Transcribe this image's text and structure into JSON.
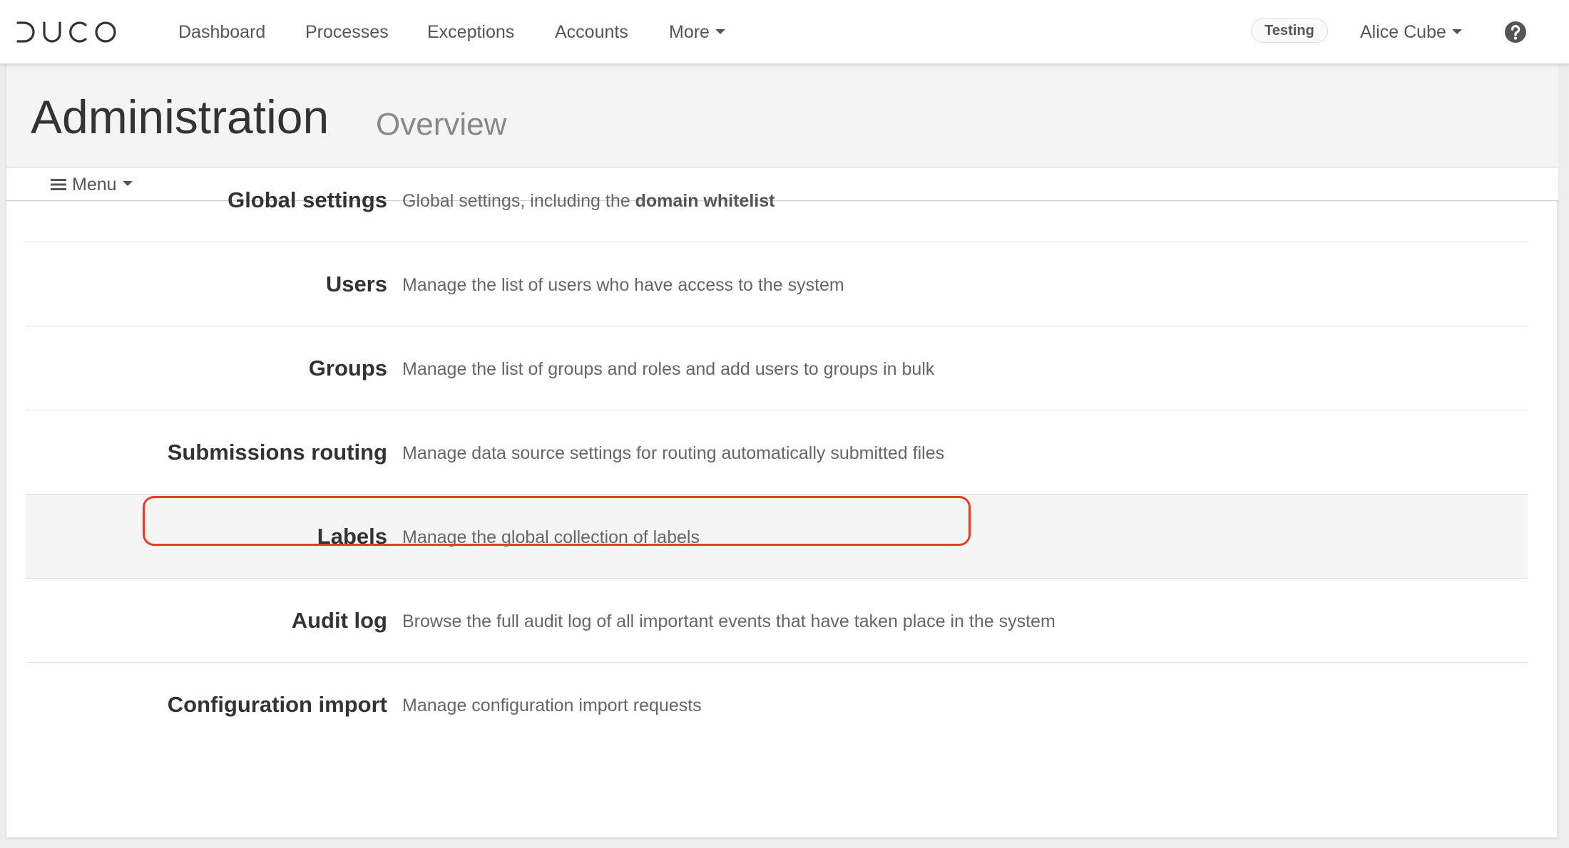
{
  "app": {
    "logo_text": "DUCO"
  },
  "nav": {
    "items": [
      {
        "label": "Dashboard"
      },
      {
        "label": "Processes"
      },
      {
        "label": "Exceptions"
      },
      {
        "label": "Accounts"
      },
      {
        "label": "More"
      }
    ],
    "environment_badge": "Testing",
    "user_name": "Alice Cube",
    "help_icon": "question-circle-icon"
  },
  "page": {
    "title": "Administration",
    "subtitle": "Overview",
    "menu_label": "Menu"
  },
  "admin_items": [
    {
      "title": "Global settings",
      "description": "Global settings, including the ",
      "description_bold": "domain whitelist"
    },
    {
      "title": "Users",
      "description": "Manage the list of users who have access to the system"
    },
    {
      "title": "Groups",
      "description": "Manage the list of groups and roles and add users to groups in bulk"
    },
    {
      "title": "Submissions routing",
      "description": "Manage data source settings for routing automatically submitted files"
    },
    {
      "title": "Labels",
      "description": "Manage the global collection of labels"
    },
    {
      "title": "Audit log",
      "description": "Browse the full audit log of all important events that have taken place in the system"
    },
    {
      "title": "Configuration import",
      "description": "Manage configuration import requests"
    }
  ],
  "colors": {
    "highlight": "#e0402a",
    "row_hover": "#f5f5f5",
    "header_bg": "#f4f4f4"
  }
}
